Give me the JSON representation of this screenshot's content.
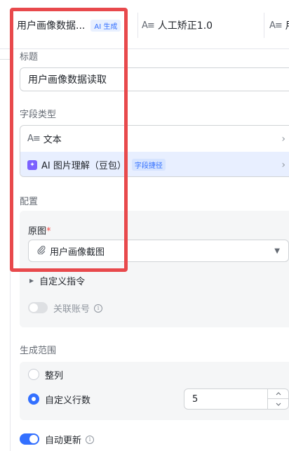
{
  "tabs": [
    {
      "label": "用户画像数据...",
      "badge": "AI 生成",
      "active": true
    },
    {
      "icon": "text-field-icon",
      "label": "人工矫正1.0"
    },
    {
      "icon": "text-field-icon",
      "label": "用"
    }
  ],
  "title_section": {
    "label": "标题",
    "value": "用户画像数据读取"
  },
  "field_type": {
    "label": "字段类型",
    "options": [
      {
        "icon": "text-field-icon",
        "label": "文本"
      },
      {
        "icon": "ai-icon",
        "label": "AI 图片理解（豆包）",
        "tag": "字段捷径",
        "selected": true
      }
    ]
  },
  "config": {
    "label": "配置",
    "origin_image": {
      "label": "原图",
      "required_mark": "*",
      "value": "用户画像截图"
    },
    "custom_command": {
      "label": "自定义指令"
    },
    "link_account": {
      "label": "关联账号",
      "enabled": false
    }
  },
  "range": {
    "label": "生成范围",
    "options": [
      {
        "label": "整列",
        "checked": false
      },
      {
        "label": "自定义行数",
        "checked": true
      }
    ],
    "rows_value": "5"
  },
  "auto_update": {
    "label": "自动更新",
    "enabled": true
  },
  "icons": {
    "info": "i",
    "chevron_right": "›",
    "dropdown": "▼",
    "caret": "▶",
    "paperclip": "📎",
    "step_up": "⌃",
    "step_down": "⌄"
  },
  "colors": {
    "accent": "#3370ff",
    "highlight": "#e8494c",
    "required": "#f54a45"
  }
}
